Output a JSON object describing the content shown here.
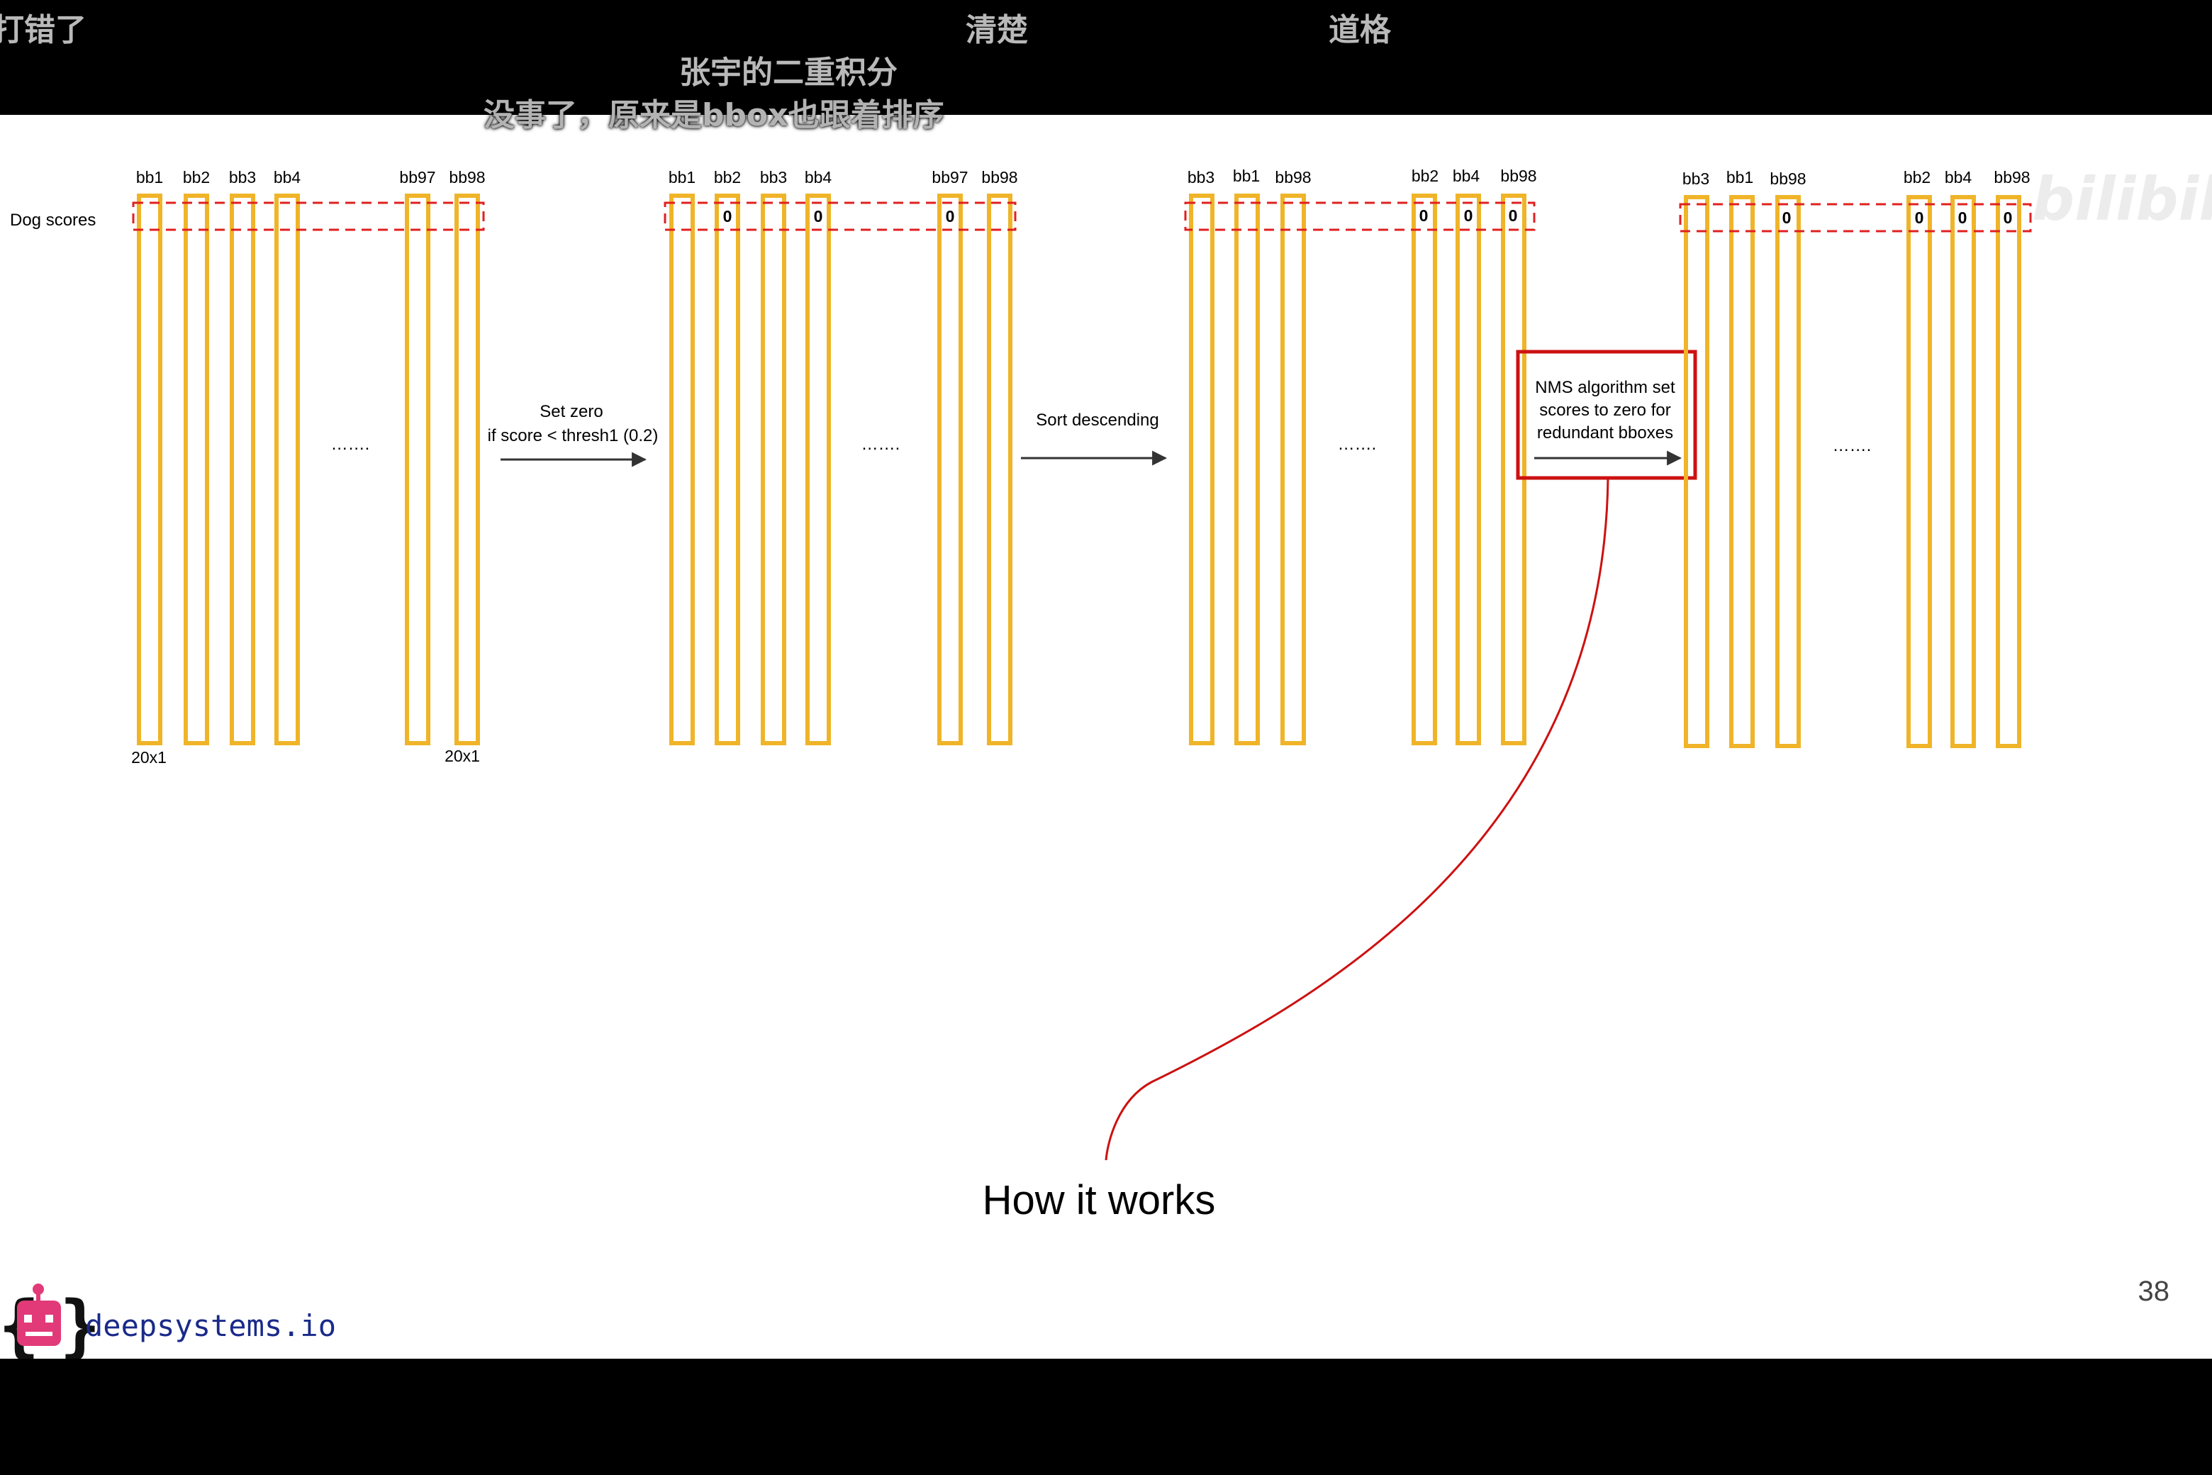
{
  "danmaku": [
    "打错了",
    "清楚",
    "道格",
    "张宇的二重积分",
    "没事了，原来是bbox也跟着排序"
  ],
  "slide": {
    "row_label": "Dog scores",
    "stages": [
      {
        "labels": [
          "bb1",
          "bb2",
          "bb3",
          "bb4",
          "bb97",
          "bb98"
        ],
        "zeros": [
          "",
          "",
          "",
          "",
          "",
          ""
        ],
        "ellipsis": "…….",
        "dims": [
          "20x1",
          "20x1"
        ]
      },
      {
        "labels": [
          "bb1",
          "bb2",
          "bb3",
          "bb4",
          "bb97",
          "bb98"
        ],
        "zeros": [
          "",
          "0",
          "",
          "0",
          "0",
          ""
        ],
        "ellipsis": "……."
      },
      {
        "labels": [
          "bb3",
          "bb1",
          "bb98",
          "bb2",
          "bb4",
          "bb98"
        ],
        "zeros": [
          "",
          "",
          "",
          "0",
          "0",
          "0"
        ],
        "ellipsis": "……."
      },
      {
        "labels": [
          "bb3",
          "bb1",
          "bb98",
          "bb2",
          "bb4",
          "bb98"
        ],
        "zeros": [
          "",
          "",
          "0",
          "0",
          "0",
          "0"
        ],
        "ellipsis": "……."
      }
    ],
    "steps": [
      [
        "Set zero",
        "if score < thresh1 (0.2)"
      ],
      [
        "Sort descending"
      ],
      [
        "NMS algorithm set",
        "scores to zero for",
        "redundant bboxes"
      ]
    ],
    "callout": "How it works",
    "page_number": "38",
    "watermark": "bilibili"
  },
  "logo": {
    "text": "deepsystems.io"
  },
  "colors": {
    "bar": "#f0b429",
    "dash": "#e02020",
    "callout": "#cc1111",
    "arrow": "#333333",
    "logo_pink": "#e23a78",
    "logo_text": "#1a2a8a",
    "danmaku": "#b9b9b9"
  }
}
